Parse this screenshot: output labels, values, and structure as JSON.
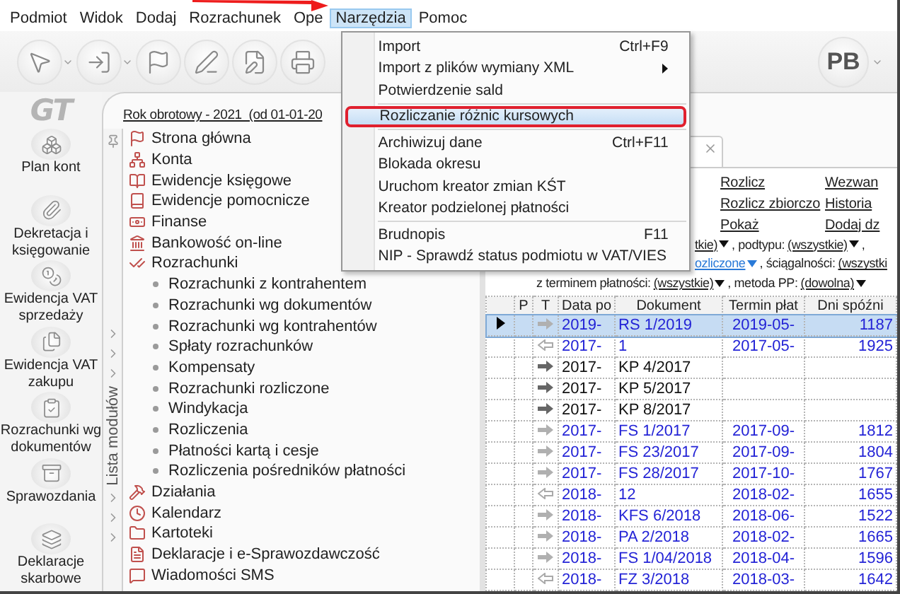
{
  "menubar": [
    {
      "label": "Podmiot",
      "selected": false
    },
    {
      "label": "Widok",
      "selected": false
    },
    {
      "label": "Dodaj",
      "selected": false
    },
    {
      "label": "Rozrachunek",
      "selected": false
    },
    {
      "label": "Ope",
      "selected": false
    },
    {
      "label": "Narzędzia",
      "selected": true,
      "menu": [
        {
          "kind": "item",
          "label": "Import",
          "shortcut": "Ctrl+F9",
          "submenu": false,
          "selected": false,
          "outlined": false
        },
        {
          "kind": "item",
          "label": "Import z plików wymiany XML",
          "submenu": true,
          "selected": false,
          "outlined": false
        },
        {
          "kind": "item",
          "label": "Potwierdzenie sald",
          "submenu": false,
          "selected": false,
          "outlined": false
        },
        {
          "kind": "separator"
        },
        {
          "kind": "item",
          "label": "Rozliczanie różnic kursowych",
          "submenu": false,
          "selected": true,
          "outlined": true
        },
        {
          "kind": "separator"
        },
        {
          "kind": "item",
          "label": "Archiwizuj dane",
          "shortcut": "Ctrl+F11",
          "submenu": false,
          "selected": false,
          "outlined": false
        },
        {
          "kind": "item",
          "label": "Blokada okresu",
          "submenu": false,
          "selected": false,
          "outlined": false
        },
        {
          "kind": "item",
          "label": "Uruchom kreator zmian KŚT",
          "submenu": false,
          "selected": false,
          "outlined": false
        },
        {
          "kind": "item",
          "label": "Kreator podzielonej płatności",
          "submenu": false,
          "selected": false,
          "outlined": false
        },
        {
          "kind": "separator"
        },
        {
          "kind": "item",
          "label": "Brudnopis",
          "shortcut": "F11",
          "submenu": false,
          "selected": false,
          "outlined": false
        },
        {
          "kind": "item",
          "label": "NIP - Sprawdź status podmiotu w VAT/VIES",
          "submenu": false,
          "selected": false,
          "outlined": false
        }
      ]
    },
    {
      "label": "Pomoc",
      "selected": false
    }
  ],
  "toolbar": {
    "buttons": [
      {
        "dropdown": true
      },
      {
        "dropdown": true
      },
      {
        "dropdown": false
      },
      {
        "dropdown": false
      },
      {
        "dropdown": false
      },
      {
        "dropdown": false
      }
    ],
    "user": {
      "initials": "PB",
      "dropdown": true
    }
  },
  "logo": "GT",
  "shortcuts": [
    {
      "label": "Plan kont"
    },
    {
      "label": "Dekretacja i księgowanie"
    },
    {
      "label": "Ewidencja VAT sprzedaży"
    },
    {
      "label": "Ewidencja VAT zakupu"
    },
    {
      "label": "Rozrachunki wg dokumentów"
    },
    {
      "label": "Sprawozdania"
    },
    {
      "label": "Deklaracje skarbowe"
    }
  ],
  "fiscal_year": "Rok obrotowy - 2021  (od 01-01-20",
  "modules": {
    "title": "Lista modułów",
    "items": [
      {
        "label": "Strona główna"
      },
      {
        "label": "Konta"
      },
      {
        "label": "Ewidencje księgowe"
      },
      {
        "label": "Ewidencje pomocnicze"
      },
      {
        "label": "Finanse"
      },
      {
        "label": "Bankowość on-line"
      },
      {
        "label": "Rozrachunki",
        "children": [
          {
            "label": "Rozrachunki z kontrahentem"
          },
          {
            "label": "Rozrachunki wg dokumentów"
          },
          {
            "label": "Rozrachunki wg kontrahentów"
          },
          {
            "label": "Spłaty rozrachunków"
          },
          {
            "label": "Kompensaty"
          },
          {
            "label": "Rozrachunki rozliczone"
          },
          {
            "label": "Windykacja"
          },
          {
            "label": "Rozliczenia"
          },
          {
            "label": "Płatności kartą i cesje"
          },
          {
            "label": "Rozliczenia pośredników płatności"
          }
        ]
      },
      {
        "label": "Działania"
      },
      {
        "label": "Kalendarz"
      },
      {
        "label": "Kartoteki"
      },
      {
        "label": "Deklaracje i e-Sprawozdawczość"
      },
      {
        "label": "Wiadomości SMS"
      }
    ]
  },
  "actions": [
    [
      "Rozlicz",
      "Wezwan"
    ],
    [
      "Rozlicz zbiorczo",
      "Historia"
    ],
    [
      "Pokaż",
      "Dodaj dz"
    ]
  ],
  "filters": [
    {
      "parts": [
        {
          "kind": "dropdown",
          "text": "tkie)"
        },
        {
          "kind": "text",
          "text": ", podtypu:"
        },
        {
          "kind": "dropdown",
          "text": "(wszystkie)"
        },
        {
          "kind": "text",
          "text": ","
        }
      ]
    },
    {
      "parts": [
        {
          "kind": "accent",
          "text": "ozliczone"
        },
        {
          "kind": "text",
          "text": ", ściągalności:"
        },
        {
          "kind": "link",
          "text": "(wszystki"
        }
      ]
    },
    {
      "parts": [
        {
          "kind": "text",
          "text": "z terminem płatności:"
        },
        {
          "kind": "dropdown",
          "text": "(wszystkie)"
        },
        {
          "kind": "text",
          "text": ", metoda PP:"
        },
        {
          "kind": "dropdown",
          "text": "(dowolna)"
        }
      ]
    }
  ],
  "table": {
    "columns": [
      "P",
      "T",
      "Data po",
      "Dokument",
      "Termin płat",
      "Dni spóźni"
    ],
    "rows": [
      {
        "selected": true,
        "kind": "receivable",
        "color": "#2323d6",
        "date": "2019-",
        "document": "RS 1/2019",
        "due": "2019-05-",
        "days": "1187"
      },
      {
        "selected": false,
        "kind": "liability",
        "color": "#2323d6",
        "date": "2017-",
        "document": "1",
        "due": "2017-05-",
        "days": "1925"
      },
      {
        "selected": false,
        "kind": "payment",
        "color": "#111111",
        "date": "2017-",
        "document": "KP 4/2017"
      },
      {
        "selected": false,
        "kind": "payment",
        "color": "#111111",
        "date": "2017-",
        "document": "KP 5/2017"
      },
      {
        "selected": false,
        "kind": "payment",
        "color": "#111111",
        "date": "2017-",
        "document": "KP 8/2017"
      },
      {
        "selected": false,
        "kind": "receivable",
        "color": "#2323d6",
        "date": "2017-",
        "document": "FS 1/2017",
        "due": "2017-09-",
        "days": "1812"
      },
      {
        "selected": false,
        "kind": "receivable",
        "color": "#2323d6",
        "date": "2017-",
        "document": "FS 23/2017",
        "due": "2017-09-",
        "days": "1804"
      },
      {
        "selected": false,
        "kind": "receivable",
        "color": "#2323d6",
        "date": "2017-",
        "document": "FS 28/2017",
        "due": "2017-10-",
        "days": "1767"
      },
      {
        "selected": false,
        "kind": "liability",
        "color": "#2323d6",
        "date": "2018-",
        "document": "12",
        "due": "2018-02-",
        "days": "1655"
      },
      {
        "selected": false,
        "kind": "receivable",
        "color": "#2323d6",
        "date": "2018-",
        "document": "KFS 6/2018",
        "due": "2018-06-",
        "days": "1522"
      },
      {
        "selected": false,
        "kind": "receivable",
        "color": "#2323d6",
        "date": "2018-",
        "document": "PA 2/2018",
        "due": "2018-02-",
        "days": "1665"
      },
      {
        "selected": false,
        "kind": "receivable",
        "color": "#2323d6",
        "date": "2018-",
        "document": "FS 1/04/2018",
        "due": "2018-04-",
        "days": "1596"
      },
      {
        "selected": false,
        "kind": "liability",
        "color": "#2323d6",
        "date": "2018-",
        "document": "FZ 3/2018",
        "due": "2018-03-",
        "days": "1642"
      }
    ]
  }
}
